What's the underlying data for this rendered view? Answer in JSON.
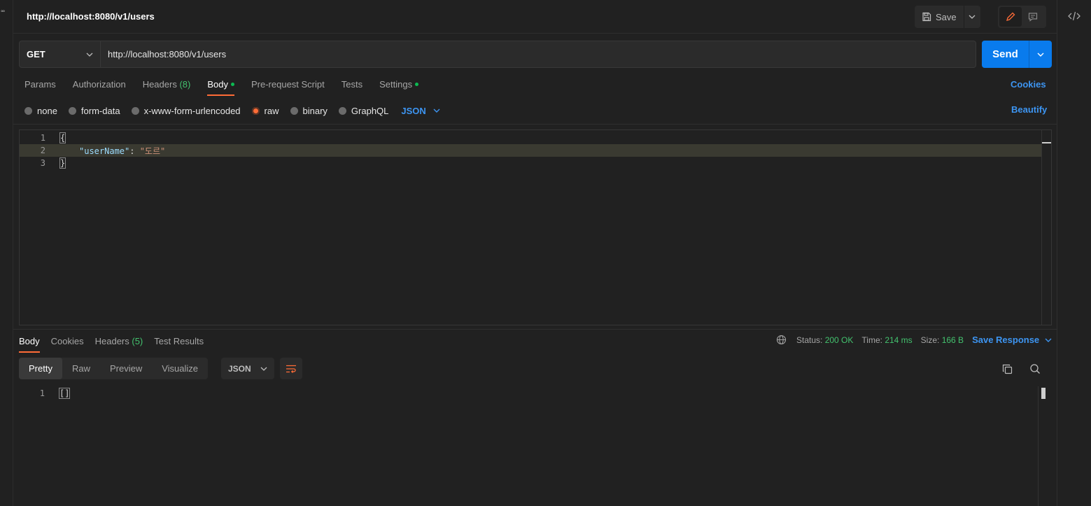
{
  "header": {
    "title": "http://localhost:8080/v1/users",
    "save_label": "Save"
  },
  "request": {
    "method": "GET",
    "url": "http://localhost:8080/v1/users",
    "send_label": "Send"
  },
  "req_tabs": {
    "params": "Params",
    "authorization": "Authorization",
    "headers": "Headers",
    "headers_count": "(8)",
    "body": "Body",
    "pre_request": "Pre-request Script",
    "tests": "Tests",
    "settings": "Settings",
    "cookies": "Cookies"
  },
  "body_options": {
    "none": "none",
    "form_data": "form-data",
    "urlencoded": "x-www-form-urlencoded",
    "raw": "raw",
    "binary": "binary",
    "graphql": "GraphQL",
    "format": "JSON",
    "beautify": "Beautify"
  },
  "editor": {
    "lines": [
      {
        "num": "1",
        "open": "{"
      },
      {
        "num": "2",
        "key": "\"userName\"",
        "colon": ": ",
        "value": "\"도르\""
      },
      {
        "num": "3",
        "close": "}"
      }
    ]
  },
  "response": {
    "tabs": {
      "body": "Body",
      "cookies": "Cookies",
      "headers": "Headers",
      "headers_count": "(5)",
      "test_results": "Test Results"
    },
    "status_label": "Status:",
    "status_value": "200 OK",
    "time_label": "Time:",
    "time_value": "214 ms",
    "size_label": "Size:",
    "size_value": "166 B",
    "save_response": "Save Response",
    "views": {
      "pretty": "Pretty",
      "raw": "Raw",
      "preview": "Preview",
      "visualize": "Visualize"
    },
    "format": "JSON",
    "line_num": "1",
    "content": "[]"
  },
  "colors": {
    "accent": "#ff6c37",
    "primary": "#097bed",
    "link": "#3d95f2",
    "success": "#43c26e"
  }
}
